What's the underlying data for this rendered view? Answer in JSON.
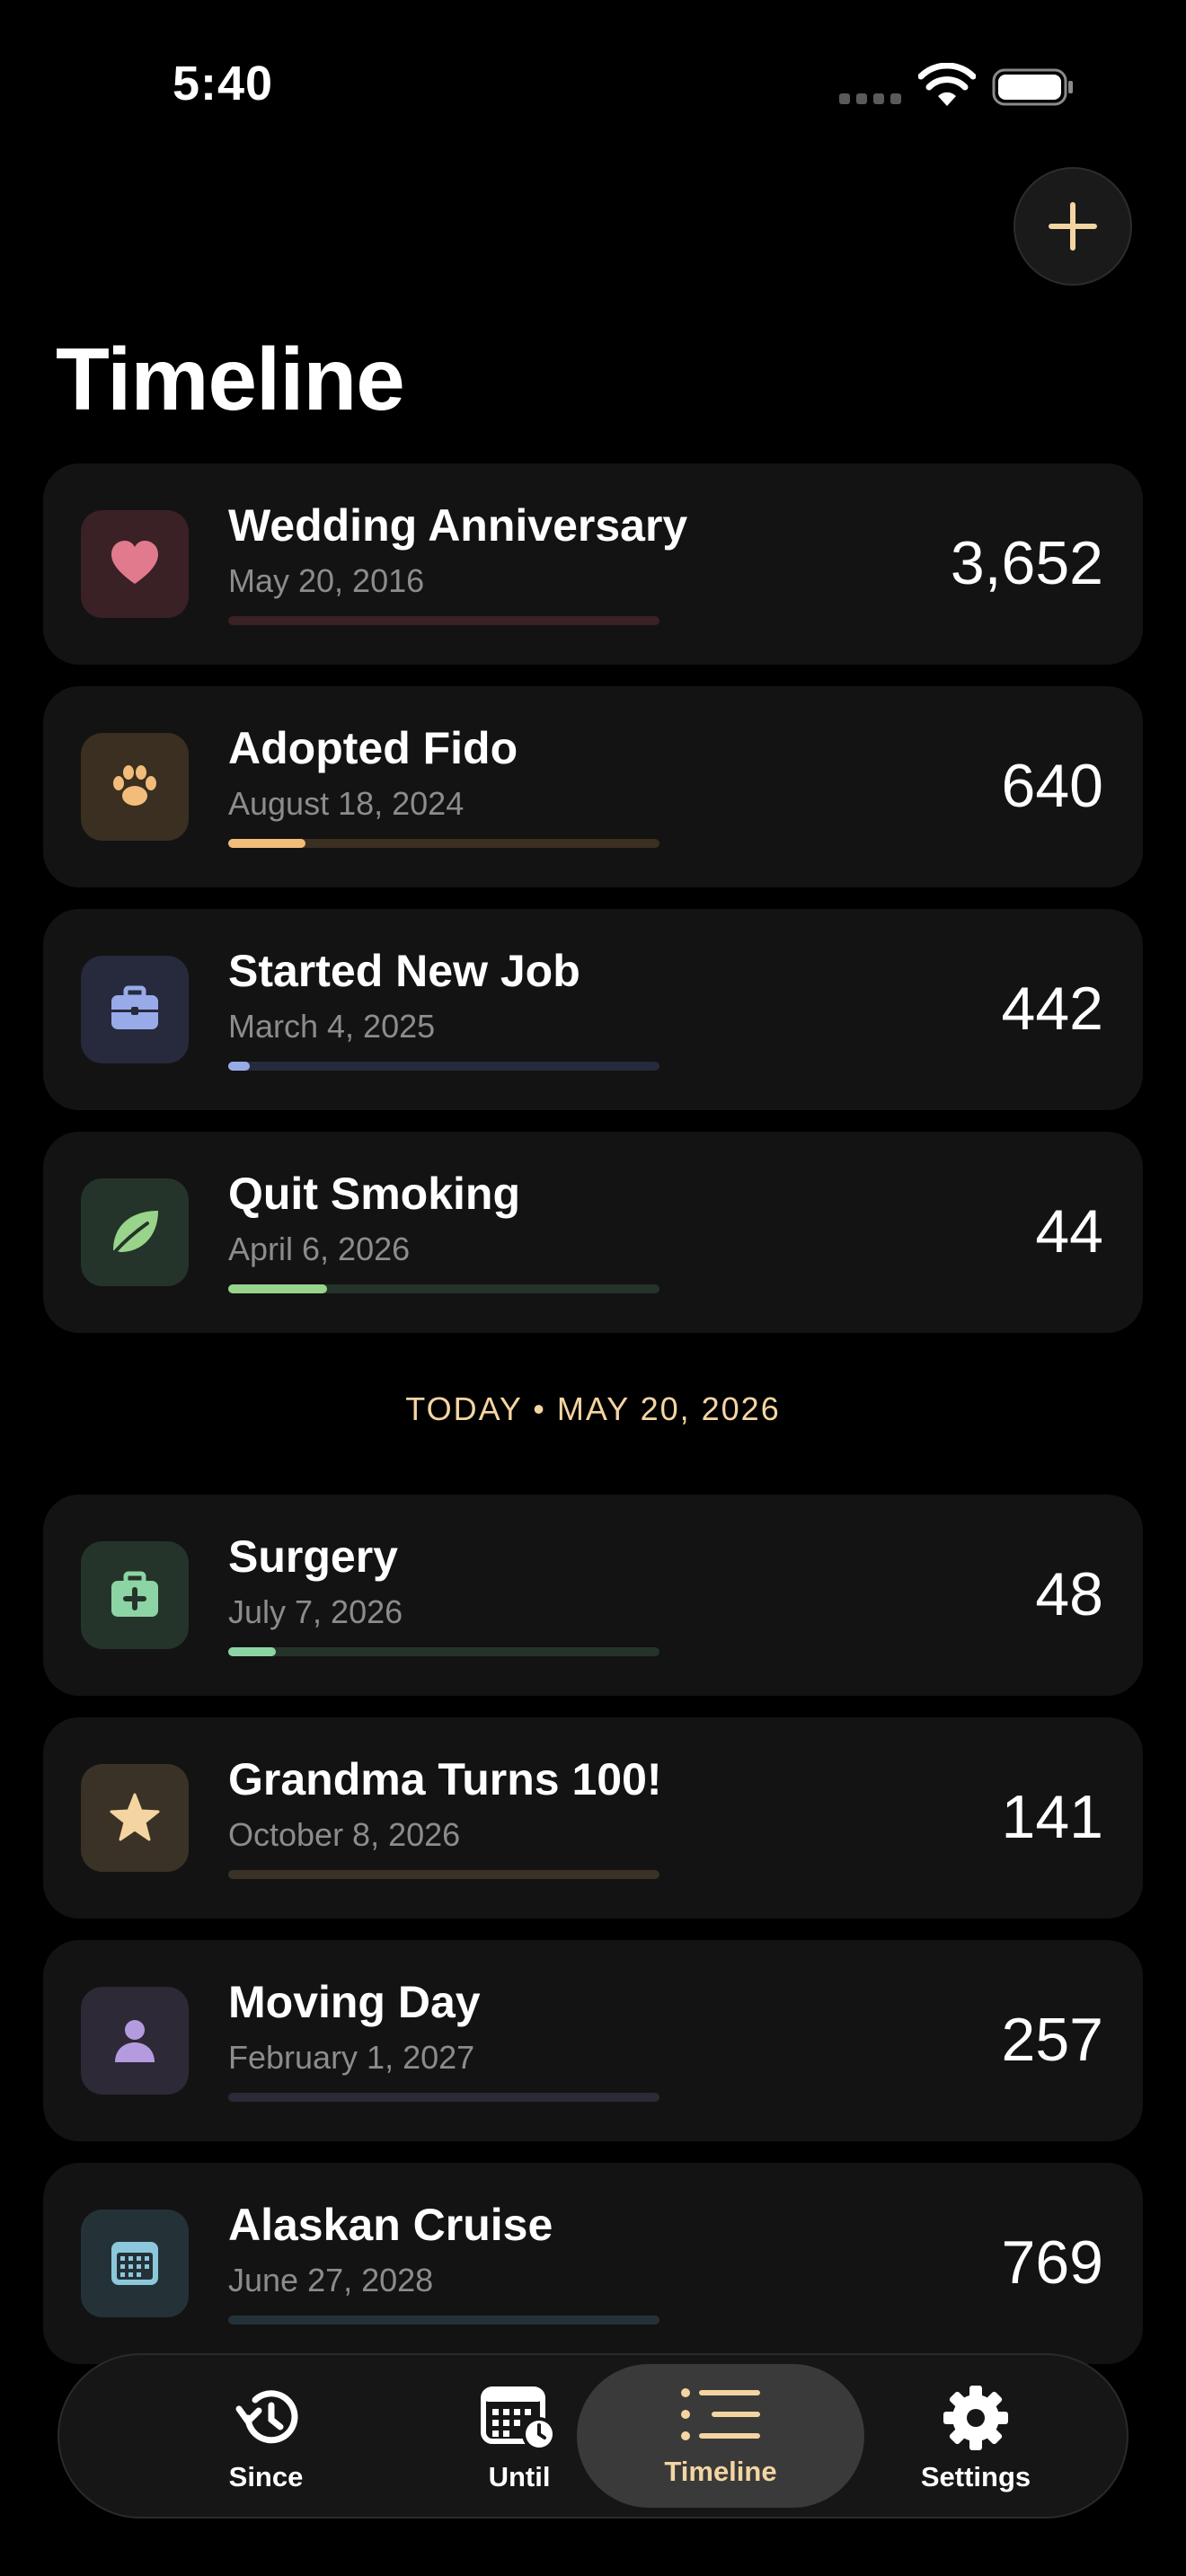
{
  "status": {
    "time": "5:40"
  },
  "header": {
    "title": "Timeline"
  },
  "colors": {
    "accent": "#f4d5a2",
    "card_bg": "#131313"
  },
  "past_events": [
    {
      "title": "Wedding Anniversary",
      "date": "May 20, 2016",
      "count": "3,652",
      "icon": "heart-icon",
      "icon_color": "#e07a8c",
      "icon_bg": "#3a2126",
      "track": "#3a2126",
      "fill": "#e07a8c",
      "progress": 0.0
    },
    {
      "title": "Adopted Fido",
      "date": "August 18, 2024",
      "count": "640",
      "icon": "paw-icon",
      "icon_color": "#f2bc7a",
      "icon_bg": "#3a2f20",
      "track": "#3a2f20",
      "fill": "#f2bc7a",
      "progress": 0.18
    },
    {
      "title": "Started New Job",
      "date": "March 4, 2025",
      "count": "442",
      "icon": "briefcase-icon",
      "icon_color": "#98abe8",
      "icon_bg": "#262a3c",
      "track": "#262a3c",
      "fill": "#98abe8",
      "progress": 0.05
    },
    {
      "title": "Quit Smoking",
      "date": "April 6, 2026",
      "count": "44",
      "icon": "leaf-icon",
      "icon_color": "#98d48a",
      "icon_bg": "#25342a",
      "track": "#25342a",
      "fill": "#98d48a",
      "progress": 0.23
    }
  ],
  "today": {
    "label": "TODAY • MAY 20, 2026"
  },
  "future_events": [
    {
      "title": "Surgery",
      "date": "July 7, 2026",
      "count": "48",
      "icon": "medkit-icon",
      "icon_color": "#8dd4a4",
      "icon_bg": "#25342a",
      "track": "#25342a",
      "fill": "#8dd4a4",
      "progress": 0.11
    },
    {
      "title": "Grandma Turns 100!",
      "date": "October 8, 2026",
      "count": "141",
      "icon": "star-icon",
      "icon_color": "#f4d5a2",
      "icon_bg": "#3a3226",
      "track": "#3a3226",
      "fill": "#f4d5a2",
      "progress": 0.0
    },
    {
      "title": "Moving Day",
      "date": "February 1, 2027",
      "count": "257",
      "icon": "person-icon",
      "icon_color": "#b49be0",
      "icon_bg": "#2e2936",
      "track": "#2e2936",
      "fill": "#b49be0",
      "progress": 0.0
    },
    {
      "title": "Alaskan Cruise",
      "date": "June 27, 2028",
      "count": "769",
      "icon": "calendar-icon",
      "icon_color": "#8cc8dc",
      "icon_bg": "#243238",
      "track": "#243238",
      "fill": "#8cc8dc",
      "progress": 0.0
    }
  ],
  "tabs": [
    {
      "label": "Since",
      "icon": "history-icon",
      "active": false
    },
    {
      "label": "Until",
      "icon": "calendar-clock-icon",
      "active": false
    },
    {
      "label": "Timeline",
      "icon": "timeline-list-icon",
      "active": true
    },
    {
      "label": "Settings",
      "icon": "gear-icon",
      "active": false
    }
  ]
}
